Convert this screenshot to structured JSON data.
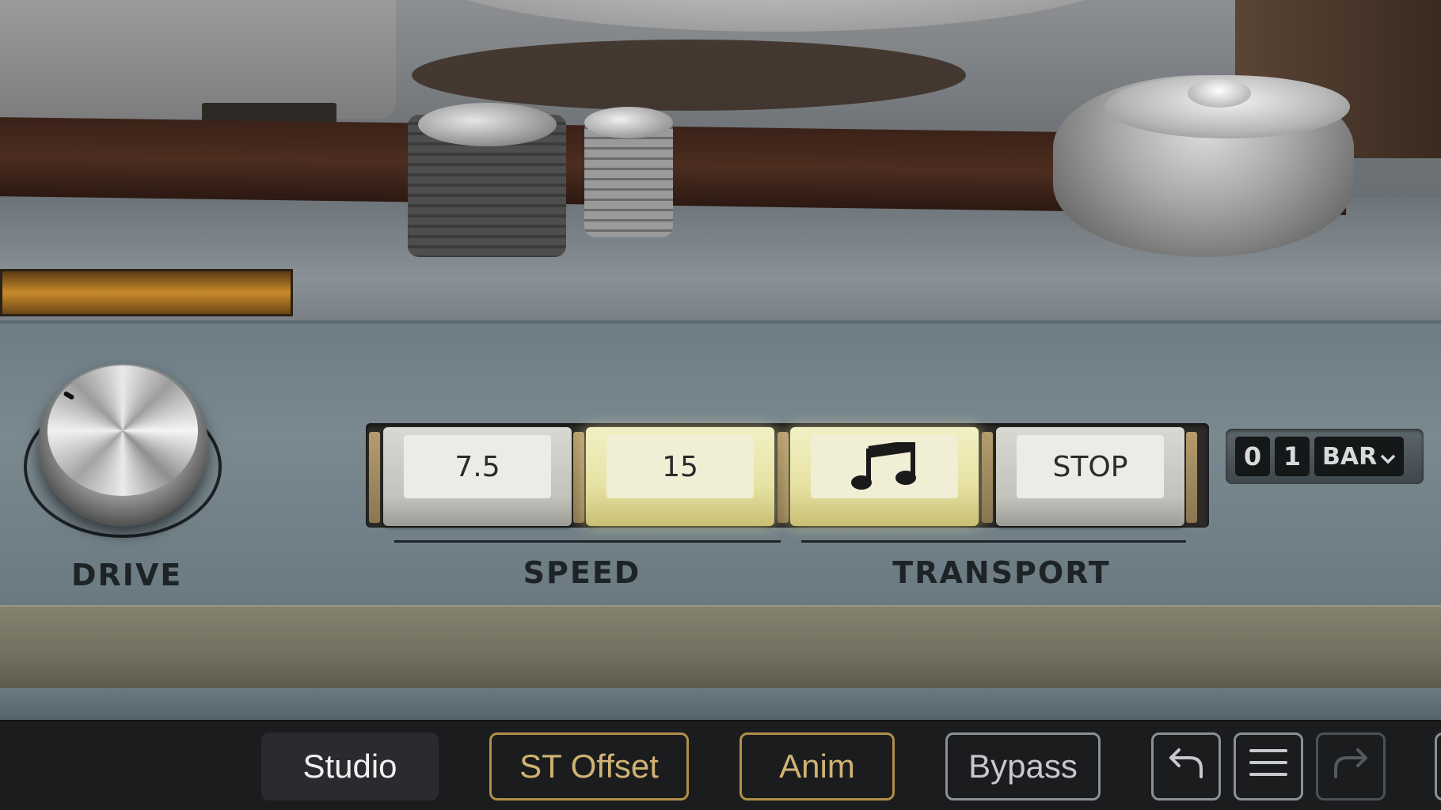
{
  "panel": {
    "drive_label": "DRIVE",
    "speed_group_label": "SPEED",
    "transport_group_label": "TRANSPORT",
    "speed_buttons": [
      "7.5",
      "15"
    ],
    "speed_selected": "15",
    "transport_play_icon": "music-note-icon",
    "transport_stop_label": "STOP",
    "counter": {
      "digits": [
        "0",
        "1"
      ],
      "unit_label": "BAR"
    }
  },
  "toolbar": {
    "studio_label": "Studio",
    "st_offset_label": "ST Offset",
    "anim_label": "Anim",
    "bypass_label": "Bypass",
    "undo_icon": "undo-icon",
    "menu_icon": "menu-icon",
    "redo_icon": "redo-icon"
  },
  "colors": {
    "accent_gold": "#b08f4a",
    "lit_button": "#f2f0c4",
    "toolbar_bg": "#1b1c1e"
  }
}
